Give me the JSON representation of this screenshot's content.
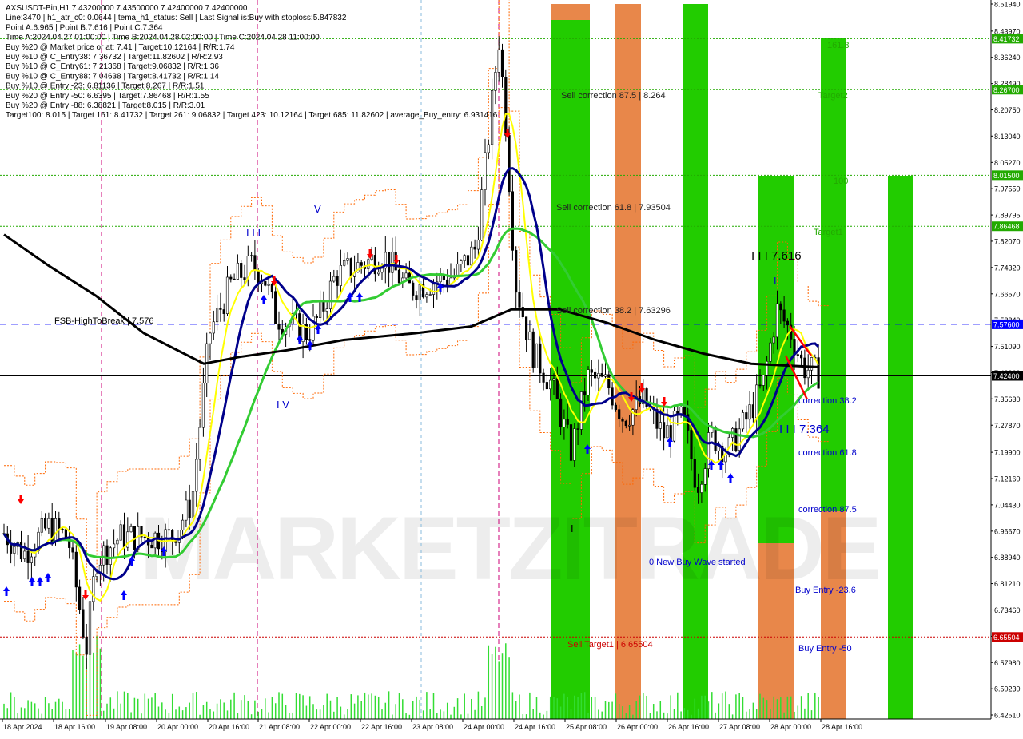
{
  "header": {
    "lines": [
      "AXSUSDT-Bin,H1  7.43200000 7.43500000 7.42400000 7.42400000",
      "Line:3470 | h1_atr_c0: 0.0644 | tema_h1_status: Sell | Last Signal is:Buy with stoploss:5.847832",
      "Point A:6.965 | Point B:7.616 | Point C:7.364",
      "Time A:2024.04.27 01:00:00 | Time B:2024.04.28 02:00:00 | Time C:2024.04.28 11:00:00",
      "Buy %20 @ Market price or at: 7.41 | Target:10.12164 | R/R:1.74",
      "Buy %10 @ C_Entry38: 7.36732 | Target:11.82602 | R/R:2.93",
      "Buy %10 @ C_Entry61: 7.21368 | Target:9.06832 | R/R:1.36",
      "Buy %10 @ C_Entry88: 7.04638 | Target:8.41732 | R/R:1.14",
      "Buy %10 @ Entry -23: 6.81136 | Target:8.267 | R/R:1.51",
      "Buy %20 @ Entry -50: 6.6395 | Target:7.86468 | R/R:1.55",
      "Buy %20 @ Entry -88: 6.38821 | Target:8.015 | R/R:3.01",
      "Target100: 8.015 | Target 161: 8.41732 | Target 261: 9.06832 | Target 423: 10.12164 | Target 685: 11.82602 | average_Buy_entry: 6.931416"
    ]
  },
  "watermark": "MARKETZITRADE",
  "colors": {
    "background": "#ffffff",
    "candle": "#000000",
    "green_band": "#22cc00",
    "orange_band": "#e8874a",
    "ma_black": "#000000",
    "ma_navy": "#00008b",
    "ma_green": "#33cc33",
    "ma_yellow": "#ffff00",
    "price_label_green": "#22aa00",
    "price_label_red": "#cc0000",
    "price_label_blue": "#0000ff",
    "current_price_bg": "#000000",
    "sell_target_text": "#cc0000",
    "level_text_green": "#22aa00",
    "blue_text": "#0000cc",
    "arrow_up": "#0000ff",
    "arrow_down": "#ff0000"
  },
  "chart_data": {
    "type": "candlestick",
    "symbol": "AXSUSDT-Bin",
    "timeframe": "H1",
    "ylim": [
      6.4,
      8.53
    ],
    "price_ticks": [
      "8.51940",
      "8.43970",
      "8.36240",
      "8.28490",
      "8.20750",
      "8.13040",
      "8.05270",
      "7.97550",
      "7.89795",
      "7.82070",
      "7.74320",
      "7.66570",
      "7.58840",
      "7.51090",
      "7.43360",
      "7.35630",
      "7.27870",
      "7.19900",
      "7.12160",
      "7.04430",
      "6.96670",
      "6.88940",
      "6.81210",
      "6.73460",
      "6.65720",
      "6.57980",
      "6.50230",
      "6.42510"
    ],
    "time_labels": [
      "18 Apr 2024",
      "18 Apr 16:00",
      "19 Apr 08:00",
      "20 Apr 00:00",
      "20 Apr 16:00",
      "21 Apr 08:00",
      "22 Apr 00:00",
      "22 Apr 16:00",
      "23 Apr 08:00",
      "24 Apr 00:00",
      "24 Apr 16:00",
      "25 Apr 08:00",
      "26 Apr 00:00",
      "26 Apr 16:00",
      "27 Apr 08:00",
      "28 Apr 00:00",
      "28 Apr 16:00"
    ],
    "levels": [
      {
        "name": "Target 161",
        "price": 8.41732,
        "label": "8.41732",
        "style": "dashed",
        "color": "#22aa00"
      },
      {
        "name": "Target2",
        "price": 8.267,
        "label": "8.26700",
        "style": "dashed",
        "color": "#22aa00"
      },
      {
        "name": "Target 100",
        "price": 8.015,
        "label": "8.01500",
        "style": "dashed",
        "color": "#22aa00"
      },
      {
        "name": "Target1",
        "price": 7.86468,
        "label": "7.86468",
        "style": "dashed",
        "color": "#22aa00"
      },
      {
        "name": "FSB-HighToBreak",
        "price": 7.576,
        "label": "7.57600",
        "style": "dashed",
        "color": "#0000ff"
      },
      {
        "name": "Current",
        "price": 7.424,
        "label": "7.42400",
        "style": "solid",
        "color": "#000000"
      },
      {
        "name": "Sell Target1",
        "price": 6.65504,
        "label": "6.65504",
        "style": "dashed",
        "color": "#cc0000"
      }
    ],
    "annotations": [
      {
        "text": "FSB-HighToBreak | 7.576",
        "price": 7.59,
        "color": "#000000"
      },
      {
        "text": "Sell correction 87.5 | 8.264",
        "price": 8.26,
        "color": "#222222"
      },
      {
        "text": "Sell correction 61.8 | 7.93504",
        "price": 7.93,
        "color": "#222222"
      },
      {
        "text": "Sell correction 38.2 | 7.63296",
        "price": 7.63,
        "color": "#222222"
      },
      {
        "text": "Sell Target1 | 6.65504",
        "price": 6.63,
        "color": "#cc0000"
      },
      {
        "text": "161.8",
        "price": 8.43,
        "color": "#22aa00"
      },
      {
        "text": "Target2",
        "price": 8.26,
        "color": "#22aa00"
      },
      {
        "text": "100",
        "price": 8.01,
        "color": "#22aa00"
      },
      {
        "text": "Target1",
        "price": 7.86,
        "color": "#22aa00"
      },
      {
        "text": "I I I 7.616",
        "price": 7.8,
        "color": "#000000"
      },
      {
        "text": "I",
        "price": 7.72,
        "color": "#0000cc"
      },
      {
        "text": "correction 38.2",
        "price": 7.36,
        "color": "#0000cc"
      },
      {
        "text": "I I I 7.364",
        "price": 7.29,
        "color": "#0000cc"
      },
      {
        "text": "correction 61.8",
        "price": 7.2,
        "color": "#0000cc"
      },
      {
        "text": "correction 87.5",
        "price": 7.04,
        "color": "#0000cc"
      },
      {
        "text": "0 New Buy Wave started",
        "price": 6.88,
        "color": "#0000cc"
      },
      {
        "text": "Buy Entry -23.6",
        "price": 6.8,
        "color": "#0000cc"
      },
      {
        "text": "Buy Entry -50",
        "price": 6.64,
        "color": "#0000cc"
      },
      {
        "text": "I I I",
        "price": 7.88,
        "color": "#0000cc"
      },
      {
        "text": "V",
        "price": 7.96,
        "color": "#0000cc"
      },
      {
        "text": "I V",
        "price": 7.37,
        "color": "#0000cc"
      },
      {
        "text": "I",
        "price": 6.97,
        "color": "#000000"
      }
    ]
  }
}
